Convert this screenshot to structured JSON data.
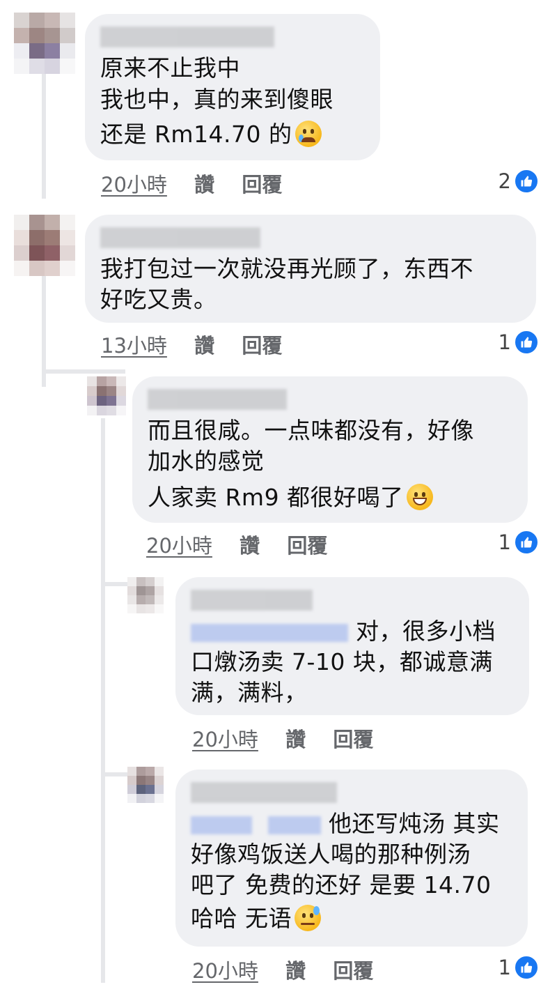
{
  "colors": {
    "bubble": "#eff0f3",
    "meta_text": "#65676b",
    "like_blue": "#1877f2"
  },
  "comments": [
    {
      "author": "",
      "lines": [
        "原来不止我中",
        "我也中，真的来到傻眼",
        "还是 Rm14.70 的"
      ],
      "emoji": "crying-face-icon",
      "time": "20小時",
      "like_label": "讚",
      "reply_label": "回覆",
      "likes": "2"
    },
    {
      "author": "",
      "lines": [
        "我打包过一次就没再光顾了，东西不",
        "好吃又贵。"
      ],
      "time": "13小時",
      "like_label": "讚",
      "reply_label": "回覆",
      "likes": "1"
    },
    {
      "author": "",
      "lines": [
        "而且很咸。一点味都没有，好像",
        "加水的感觉",
        "人家卖 Rm9 都很好喝了"
      ],
      "emoji": "grinning-face-icon",
      "time": "20小時",
      "like_label": "讚",
      "reply_label": "回覆",
      "likes": "1"
    },
    {
      "author": "",
      "lines": [
        "对，很多小档",
        "口燉汤卖 7-10 块，都诚意满",
        "满，满料，"
      ],
      "time": "20小時",
      "like_label": "讚",
      "reply_label": "回覆",
      "likes": ""
    },
    {
      "author": "",
      "lines": [
        "他还写炖汤 其实",
        "好像鸡饭送人喝的那种例汤",
        "吧了 免费的还好 是要 14.70",
        "哈哈 无语"
      ],
      "emoji": "downcast-sweat-face-icon",
      "time": "20小時",
      "like_label": "讚",
      "reply_label": "回覆",
      "likes": "1"
    }
  ]
}
